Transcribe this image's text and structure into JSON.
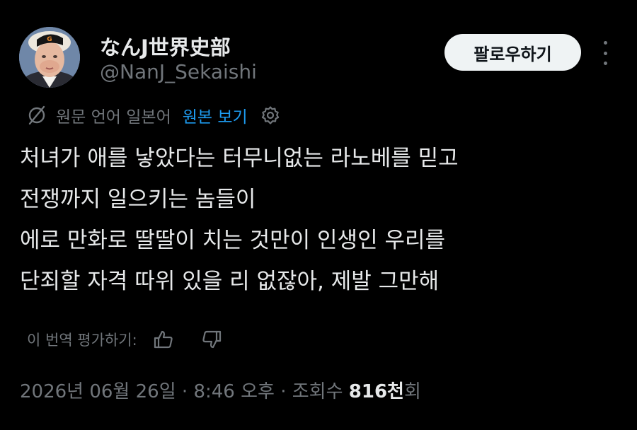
{
  "profile": {
    "display_name": "なんJ世界史部",
    "handle": "@NanJ_Sekaishi",
    "follow_label": "팔로우하기"
  },
  "translation": {
    "label": "원문 언어 일본어",
    "show_original": "원본 보기"
  },
  "tweet": {
    "lines": [
      "처녀가 애를 낳았다는 터무니없는 라노베를 믿고",
      "전쟁까지 일으키는 놈들이",
      "에로 만화로 딸딸이 치는 것만이 인생인 우리를",
      "단죄할 자격 따위 있을 리 없잖아, 제발 그만해"
    ]
  },
  "rating": {
    "label": "이 번역 평가하기:"
  },
  "meta": {
    "date": "2026년 06월 26일",
    "separator": " · ",
    "time": "8:46 오후",
    "views_label": "조회수 ",
    "views_count": "816천",
    "views_suffix": "회"
  },
  "icons": {
    "translation": "globe-off-icon",
    "settings": "gear-icon",
    "more": "more-dots-vertical-icon",
    "rate_good": "thumb-up-icon",
    "rate_bad": "thumb-down-icon"
  },
  "colors": {
    "background": "#000000",
    "primary_text": "#e7e9ea",
    "secondary_text": "#71767b",
    "link": "#1d9bf0",
    "follow_button_bg": "#eff3f4",
    "follow_button_text": "#0f1419"
  }
}
